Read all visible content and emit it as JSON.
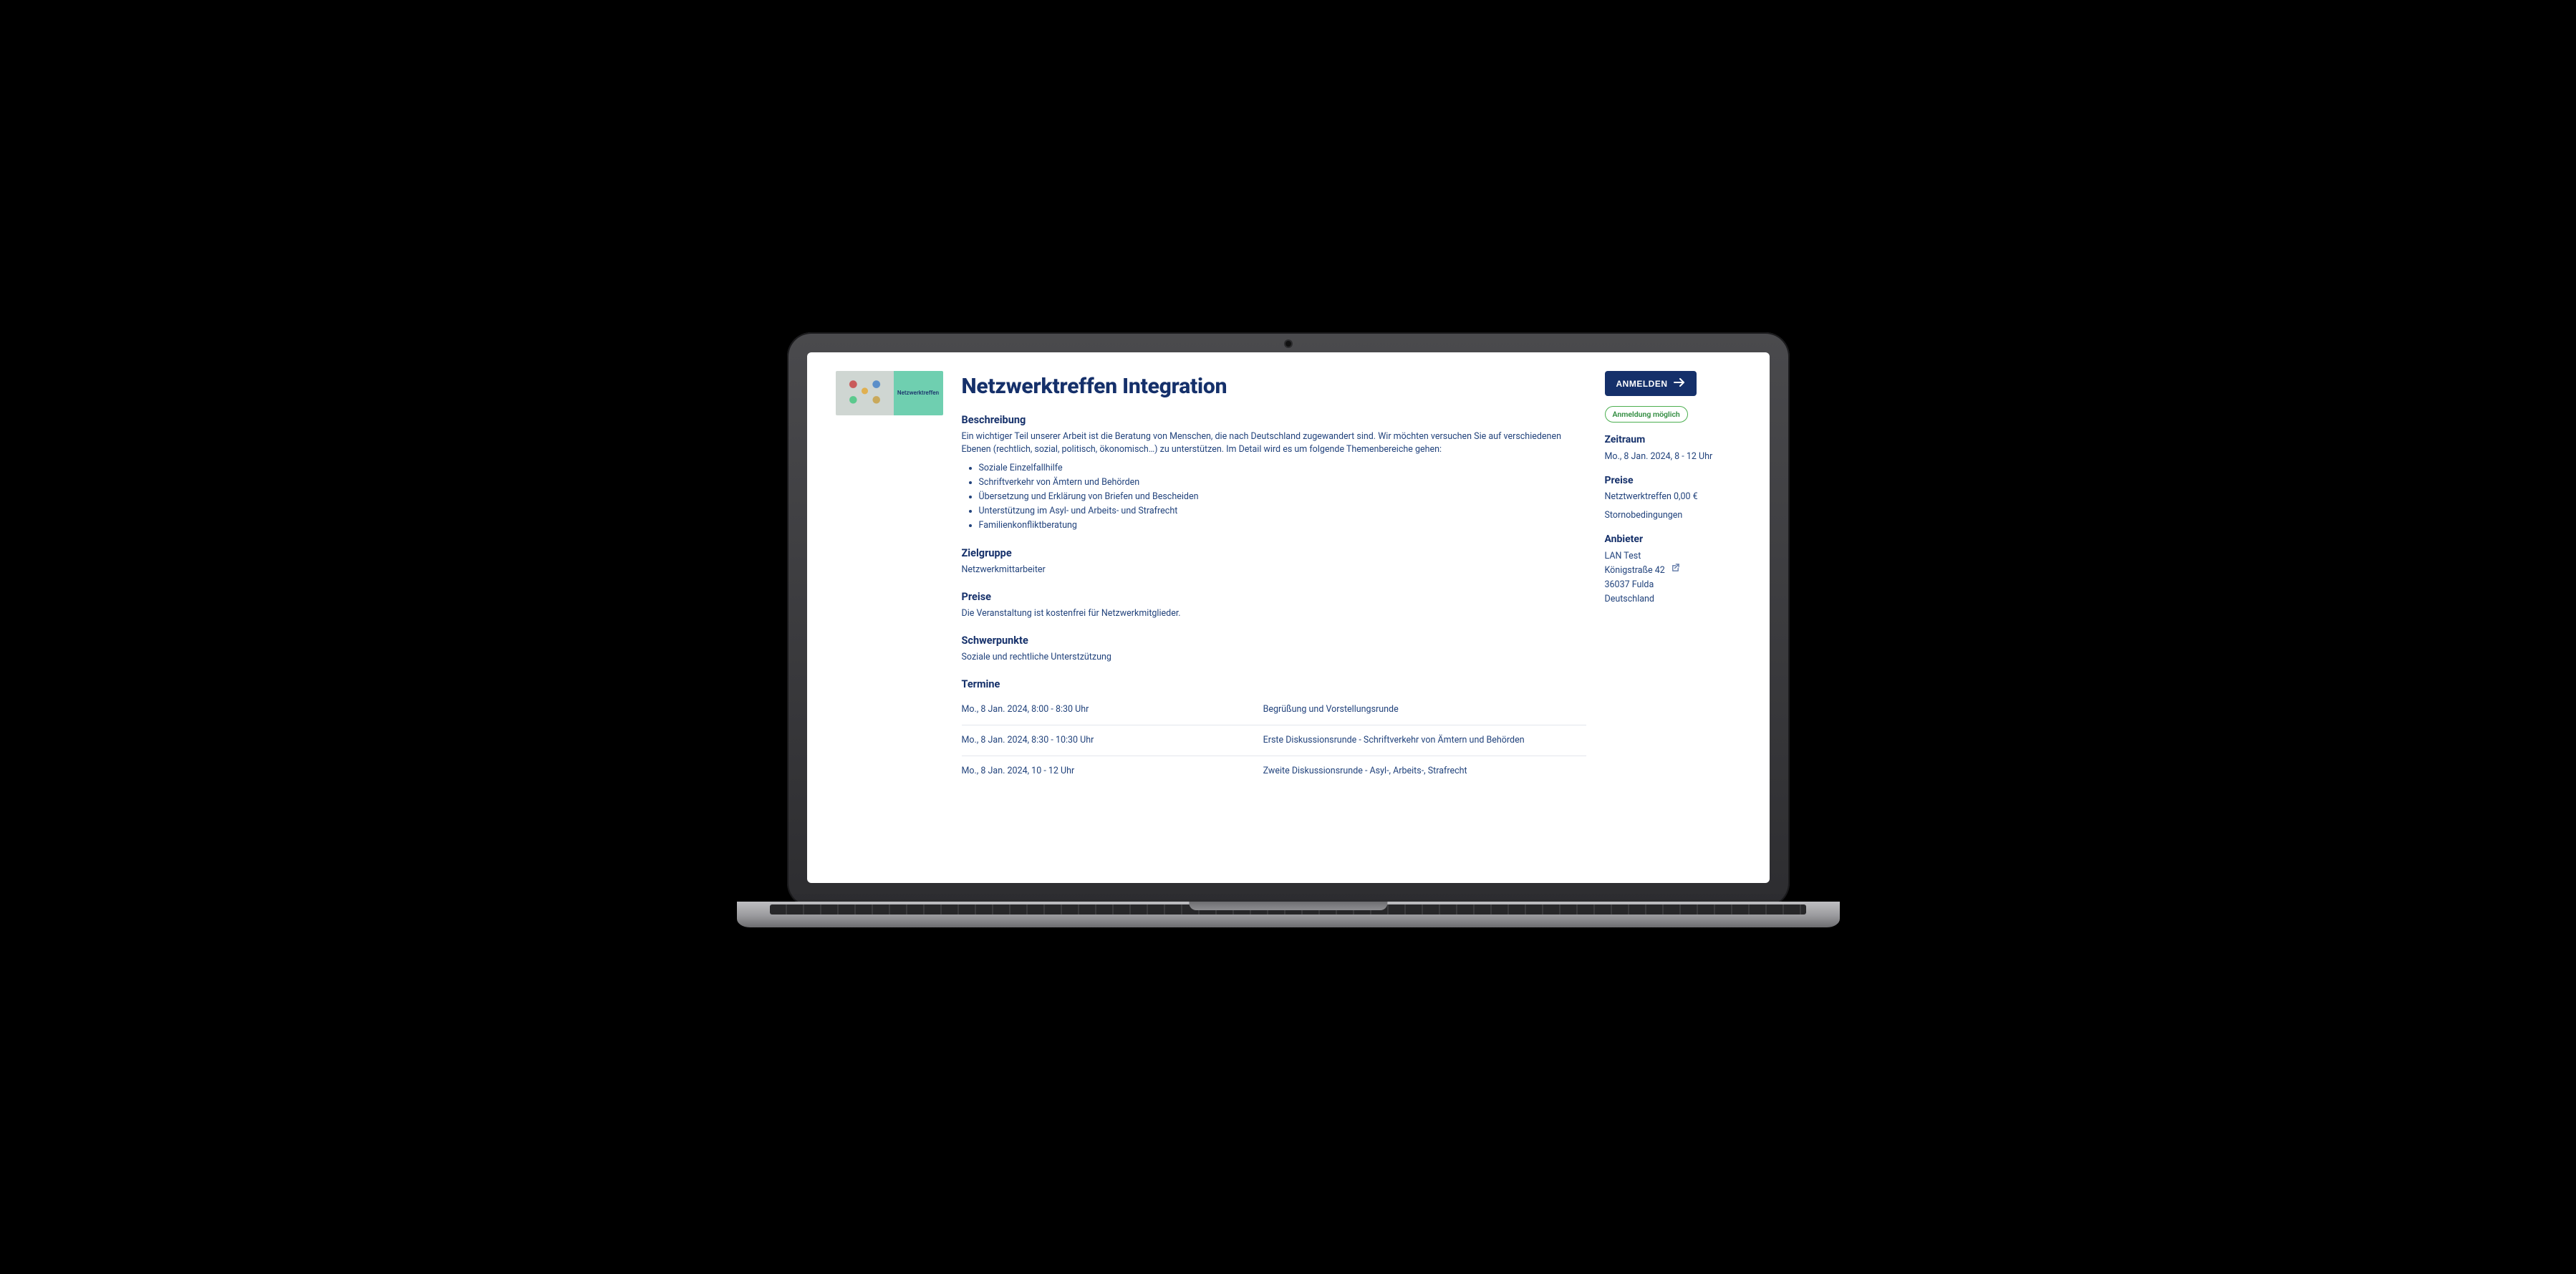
{
  "thumb": {
    "caption": "Netzwerktreffen"
  },
  "main": {
    "title": "Netzwerktreffen Integration",
    "description": {
      "heading": "Beschreibung",
      "intro": "Ein wichtiger Teil unserer Arbeit ist die Beratung von Menschen, die nach Deutschland zugewandert sind. Wir möchten versuchen Sie auf verschiedenen Ebenen (rechtlich, sozial, politisch, ökonomisch…) zu unterstützen. Im Detail wird es um folgende Themenbereiche gehen:",
      "topics": [
        "Soziale Einzelfallhilfe",
        "Schriftverkehr von Ämtern und Behörden",
        "Übersetzung und Erklärung von Briefen und Bescheiden",
        "Unterstützung im Asyl- und Arbeits- und Strafrecht",
        "Familienkonfliktberatung"
      ]
    },
    "target_group": {
      "heading": "Zielgruppe",
      "value": "Netzwerkmittarbeiter"
    },
    "prices": {
      "heading": "Preise",
      "value": "Die Veranstaltung ist kostenfrei für Netzwerkmitglieder."
    },
    "focus": {
      "heading": "Schwerpunkte",
      "value": "Soziale und rechtliche Unterstzützung"
    },
    "schedule": {
      "heading": "Termine",
      "rows": [
        {
          "time": "Mo., 8 Jan. 2024, 8:00 - 8:30 Uhr",
          "topic": "Begrüßung und Vorstellungsrunde"
        },
        {
          "time": "Mo., 8 Jan. 2024, 8:30 - 10:30 Uhr",
          "topic": "Erste Diskussionsrunde - Schriftverkehr von Ämtern und Behörden"
        },
        {
          "time": "Mo., 8 Jan. 2024, 10 - 12 Uhr",
          "topic": "Zweite Diskussionsrunde - Asyl-, Arbeits-, Strafrecht"
        }
      ]
    }
  },
  "side": {
    "signup_label": "ANMELDEN",
    "status": "Anmeldung möglich",
    "period": {
      "heading": "Zeitraum",
      "value": "Mo., 8 Jan. 2024, 8 - 12 Uhr"
    },
    "prices": {
      "heading": "Preise",
      "value": "Netztwerktreffen 0,00 €",
      "cancel": "Stornobedingungen"
    },
    "provider": {
      "heading": "Anbieter",
      "name": "LAN Test",
      "street": "Königstraße 42",
      "city": "36037 Fulda",
      "country": "Deutschland"
    }
  }
}
